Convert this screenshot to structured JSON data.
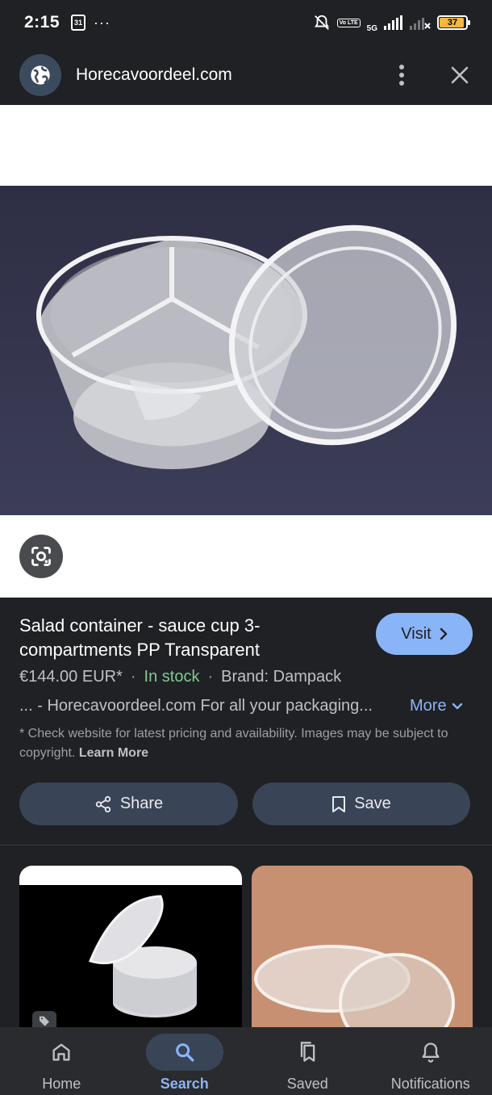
{
  "status_bar": {
    "time": "2:15",
    "calendar_day": "31",
    "overflow": "···",
    "network": "5G",
    "lte": "Vo LTE",
    "battery": "37"
  },
  "browser": {
    "site_title": "Horecavoordeel.com"
  },
  "product": {
    "title": "Salad container - sauce cup 3-compartments PP Transparent",
    "visit_label": "Visit",
    "price": "€144.00 EUR*",
    "dot1": "·",
    "availability": "In stock",
    "dot2": "·",
    "brand": "Brand: Dampack",
    "snippet": "... - Horecavoordeel.com For all your packaging...",
    "more_label": "More",
    "disclaimer": "* Check website for latest pricing and availability. Images may be subject to copyright.",
    "learn_more": "Learn More",
    "share_label": "Share",
    "save_label": "Save"
  },
  "nav": {
    "items": [
      {
        "label": "Home",
        "icon": "home-icon",
        "active": false
      },
      {
        "label": "Search",
        "icon": "search-icon",
        "active": true
      },
      {
        "label": "Saved",
        "icon": "saved-icon",
        "active": false
      },
      {
        "label": "Notifications",
        "icon": "bell-icon",
        "active": false
      }
    ]
  },
  "colors": {
    "background": "#202124",
    "accent": "#8ab4f8",
    "in_stock": "#81c995",
    "button_bg": "#394457"
  }
}
